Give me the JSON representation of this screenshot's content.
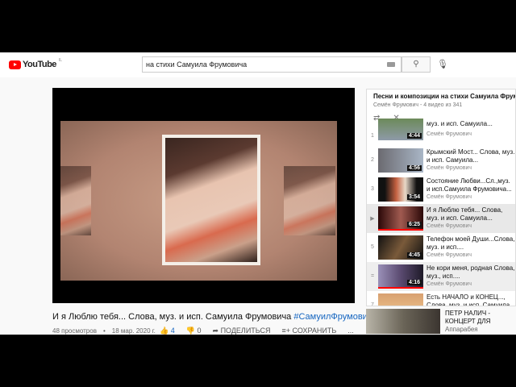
{
  "header": {
    "logo": "YouTube",
    "logo_suffix": "IL",
    "search_value": "на стихи Самуила Фрумовича",
    "search_icon": "search-icon",
    "keyboard_icon": "keyboard-icon",
    "mic_icon": "mic-icon"
  },
  "video": {
    "title": "И я Люблю тебя... Слова, муз. и исп. Самуила Фрумовича",
    "hashtag": "#СамуилФрумович",
    "views": "48 просмотров",
    "date": "18 мар. 2020 г.",
    "likes": "4",
    "dislikes": "0",
    "share": "ПОДЕЛИТЬСЯ",
    "save": "СОХРАНИТЬ",
    "more": "..."
  },
  "playlist": {
    "title": "Песни и композиции на стихи Самуила Фрумовича",
    "subtitle": "Семён Фрумович - 4 видео из 341",
    "items": [
      {
        "num": "1",
        "title": "муз. и исп. Самуила...",
        "channel": "Семён Фрумович",
        "duration": "4:44"
      },
      {
        "num": "2",
        "title": "Крымский Мост... Слова, муз. и исп. Самуила...",
        "channel": "Семён Фрумович",
        "duration": "4:56"
      },
      {
        "num": "3",
        "title": "Состояние Любви...Сл.,муз. и исп.Самуила Фрумовича...",
        "channel": "Семён Фрумович",
        "duration": "3:54"
      },
      {
        "num": "▶",
        "title": "И я Люблю тебя... Слова, муз. и исп. Самуила...",
        "channel": "Семён Фрумович",
        "duration": "6:25"
      },
      {
        "num": "5",
        "title": "Телефон моей Души...Слова, муз. и исп....",
        "channel": "Семён Фрумович",
        "duration": "4:45"
      },
      {
        "num": "=",
        "title": "Не кори меня, родная Слова, муз., исп....",
        "channel": "Семён Фрумович",
        "duration": "4:16"
      },
      {
        "num": "7",
        "title": "Есть НАЧАЛО и КОНЕЦ..., Слова, муз. и исп. Самуила...",
        "channel": "",
        "duration": ""
      }
    ]
  },
  "recommended": {
    "title": "ПЕТР НАЛИЧ - КОНЦЕРТ ДЛЯ ВОЛОНТЕРОВ В...",
    "channel": "Аппарабея"
  }
}
